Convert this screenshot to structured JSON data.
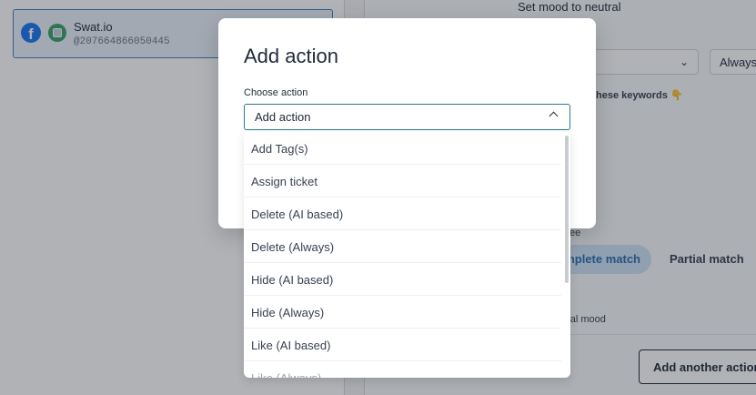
{
  "background": {
    "account": {
      "name": "Swat.io",
      "id": "@207664866050445",
      "icons": [
        "facebook-icon",
        "swat-io-icon"
      ]
    },
    "rule_panel": {
      "action_text": "Set mood to neutral",
      "mode_select": "Always",
      "keywords_label": "hese keywords",
      "keywords_icon": "👇",
      "partial_label": "ee",
      "complete_match": "mplete match",
      "partial_match": "Partial match",
      "mood_text": "tral mood",
      "add_another": "Add another action"
    }
  },
  "modal": {
    "title": "Add action",
    "field_label": "Choose action",
    "select_value": "Add action",
    "select_icon": "chevron-up-icon",
    "options": [
      "Add Tag(s)",
      "Assign ticket",
      "Delete (AI based)",
      "Delete (Always)",
      "Hide (AI based)",
      "Hide (Always)",
      "Like (AI based)",
      "Like (Always)"
    ]
  },
  "colors": {
    "accent": "#2c7a8c",
    "selected_chip_bg": "#cfe4f6",
    "selected_chip_text": "#2b6cb0",
    "facebook": "#1877f2"
  }
}
